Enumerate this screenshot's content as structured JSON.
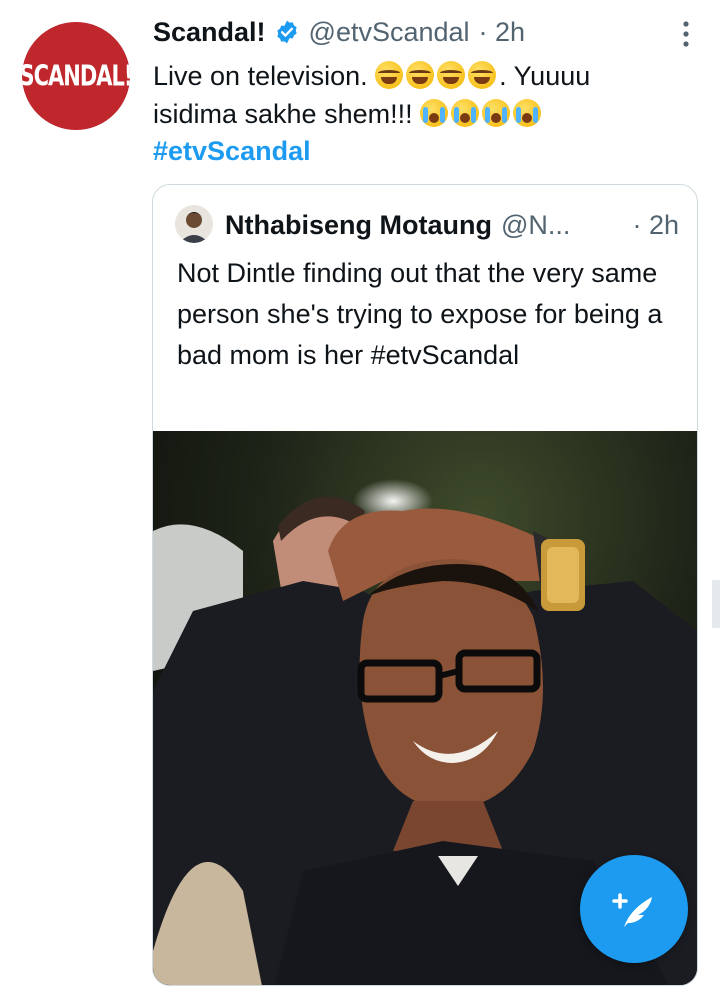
{
  "tweet": {
    "avatar_text": "SCANDAL!",
    "display_name": "Scandal!",
    "handle": "@etvScandal",
    "time": "· 2h",
    "line1": "Live on television. ",
    "line1_end": ". Yuuuu",
    "line2": "isidima sakhe shem!!! ",
    "hashtag": "#etvScandal",
    "emoji_laugh": [
      "tears-of-joy",
      "tears-of-joy",
      "tears-of-joy",
      "tears-of-joy"
    ],
    "emoji_cry": [
      "loudly-crying",
      "loudly-crying",
      "loudly-crying",
      "loudly-crying"
    ]
  },
  "quote": {
    "display_name": "Nthabiseng Motaung",
    "handle": "@N...",
    "time": "· 2h",
    "text": "Not Dintle finding out that the very same person she's trying to expose for being a bad mom is her #etvScandal"
  },
  "icons": {
    "verified": "verified-badge-icon",
    "more": "more-options-icon",
    "compose": "compose-tweet-icon"
  },
  "colors": {
    "accent": "#1d9bf0",
    "secondary_text": "#536471",
    "brand_red": "#c0272d"
  }
}
